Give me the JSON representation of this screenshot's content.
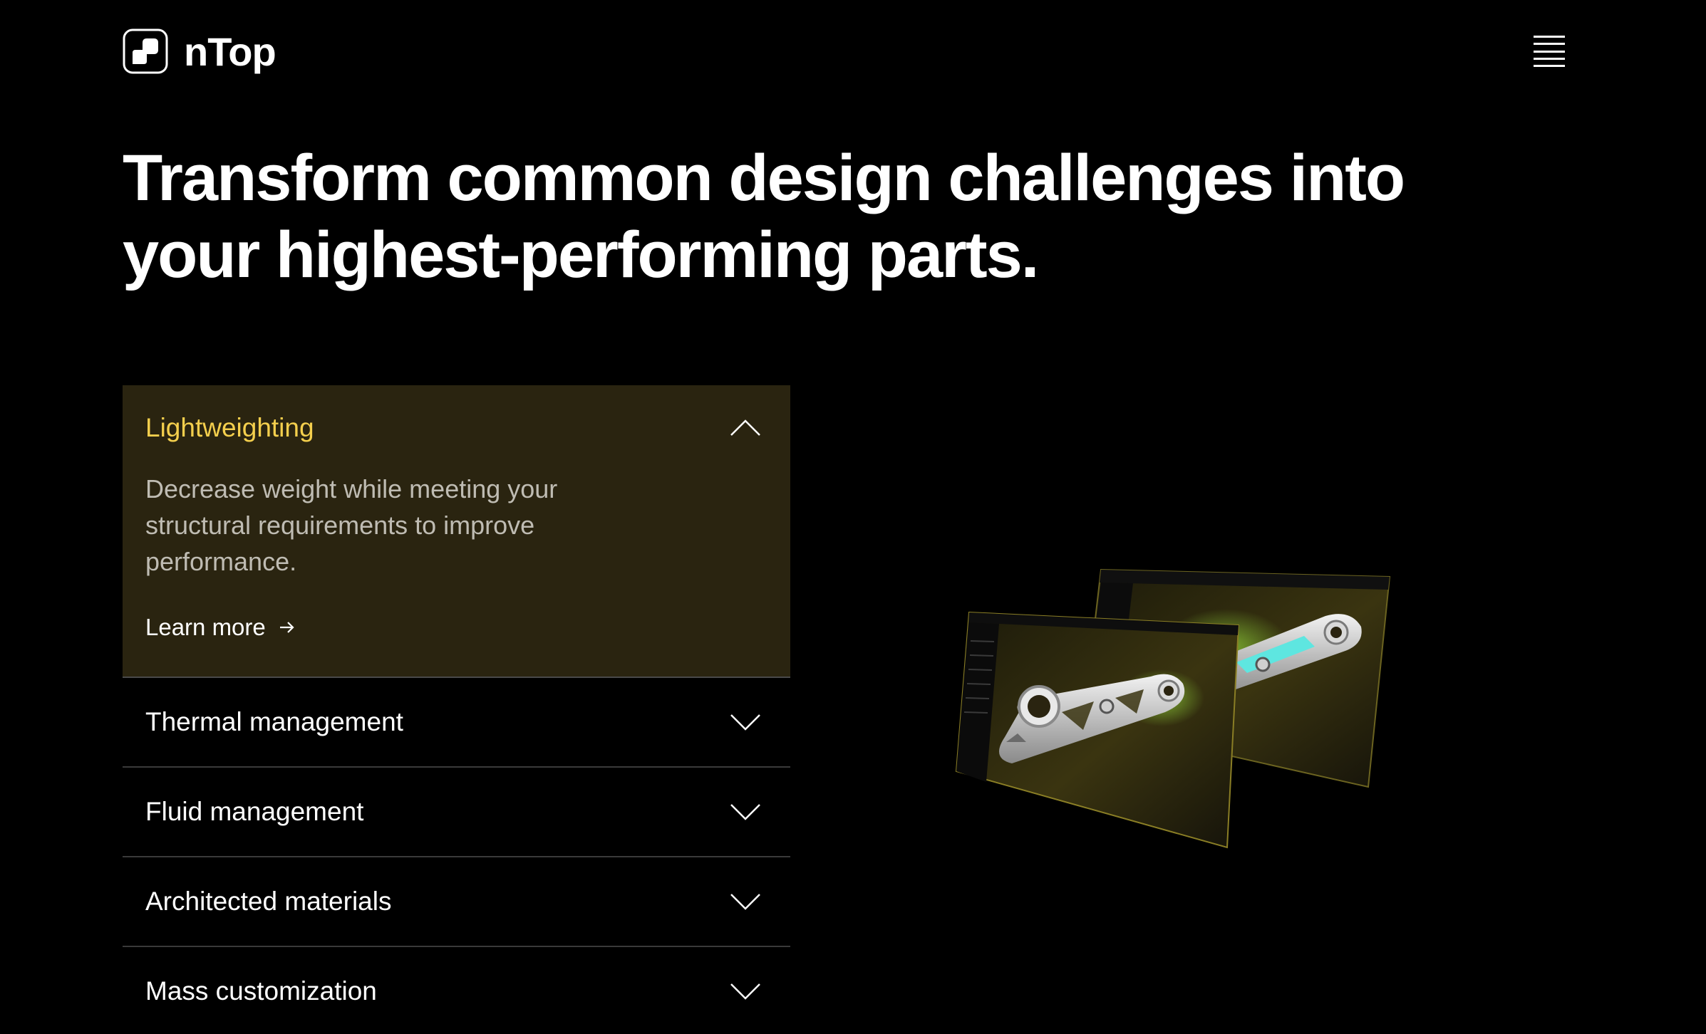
{
  "header": {
    "brand_name": "nTop",
    "logo_icon": "ntop-logo-icon",
    "menu_icon": "hamburger-menu-icon"
  },
  "hero": {
    "headline": "Transform common design challenges into your highest-performing parts."
  },
  "accordion": {
    "items": [
      {
        "title": "Lightweighting",
        "expanded": true,
        "description": "Decrease weight while meeting your structural requirements to improve performance.",
        "link_label": "Learn more"
      },
      {
        "title": "Thermal management",
        "expanded": false
      },
      {
        "title": "Fluid management",
        "expanded": false
      },
      {
        "title": "Architected materials",
        "expanded": false
      },
      {
        "title": "Mass customization",
        "expanded": false
      }
    ]
  },
  "colors": {
    "background": "#000000",
    "accent_yellow": "#f4cf4d",
    "open_panel": "#2a2410",
    "divider": "#3a3a3a",
    "muted_text": "#bfbcb3",
    "highlight_cyan": "#5ee6e0"
  }
}
